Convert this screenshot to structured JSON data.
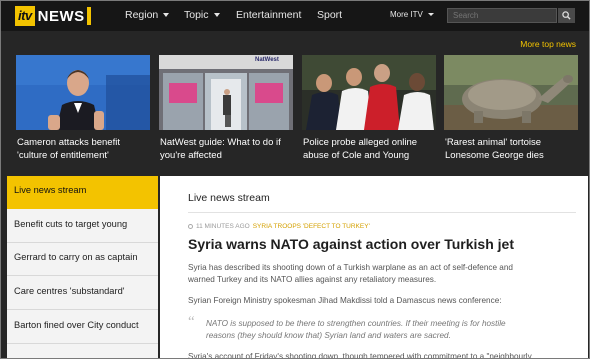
{
  "logo": {
    "itv": "itv",
    "news": "NEWS"
  },
  "nav": {
    "region": "Region",
    "topic": "Topic",
    "entertainment": "Entertainment",
    "sport": "Sport",
    "more_itv": "More ITV"
  },
  "search": {
    "placeholder": "Search"
  },
  "more_top_news": "More top news",
  "cards": [
    {
      "caption": "Cameron attacks benefit 'culture of entitlement'"
    },
    {
      "caption": "NatWest guide: What to do if you're affected",
      "sign": "NatWest"
    },
    {
      "caption": "Police probe alleged online abuse of Cole and Young"
    },
    {
      "caption": "'Rarest animal' tortoise Lonesome George dies"
    }
  ],
  "sidebar": {
    "items": [
      {
        "label": "Live news stream"
      },
      {
        "label": "Benefit cuts to target young"
      },
      {
        "label": "Gerrard to carry on as captain"
      },
      {
        "label": "Care centres 'substandard'"
      },
      {
        "label": "Barton fined over City conduct"
      }
    ]
  },
  "main": {
    "heading": "Live news stream",
    "time": "11 MINUTES AGO",
    "tag": "SYRIA TROOPS 'DEFECT TO TURKEY'",
    "headline": "Syria warns NATO against action over Turkish jet",
    "para1_line1": "Syria has described its shooting down of a Turkish warplane as an act of self-defence and",
    "para1_line2": "warned Turkey and its NATO allies against any retaliatory measures.",
    "para2": "Syrian Foreign Ministry spokesman Jihad Makdissi told a Damascus news conference:",
    "quote_line1": "NATO is supposed to be there to strengthen countries. If their meeting is for hostile",
    "quote_line2": "reasons (they should know that) Syrian land and waters are sacred.",
    "para3": "Syria's account of Friday's shooting down, though tempered with commitment to a \"neighbourly"
  },
  "colors": {
    "accent": "#f3c300",
    "topbar": "#161616",
    "background": "#262626"
  }
}
